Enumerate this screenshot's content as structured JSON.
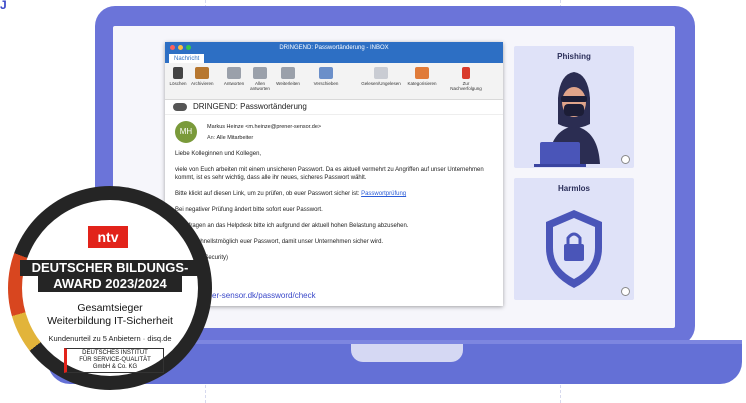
{
  "corner_mark": "J",
  "mail": {
    "window_title": "DRINGEND: Passwortänderung - INBOX",
    "ribbon_tab": "Nachricht",
    "toolbar": [
      {
        "label": "Löschen",
        "icon": "delete-icon"
      },
      {
        "label": "Archivieren",
        "icon": "archive-icon"
      },
      {
        "label": "Antworten",
        "icon": "reply-icon"
      },
      {
        "label": "Allen antworten",
        "icon": "reply-all-icon"
      },
      {
        "label": "Weiterleiten",
        "icon": "forward-icon"
      },
      {
        "label": "Verschieben",
        "icon": "move-icon"
      },
      {
        "label": "Gelesen/Ungelesen",
        "icon": "read-unread-icon"
      },
      {
        "label": "Kategorisieren",
        "icon": "categorize-icon"
      },
      {
        "label": "Zur Nachverfolgung",
        "icon": "flag-icon"
      }
    ],
    "subject": "DRINGEND: Passwortänderung",
    "avatar_initials": "MH",
    "sender": "Markus Heinze <m.heinze@prener-sensor.de>",
    "to_label": "An:",
    "to_value": "Alle Mitarbeiter",
    "body": {
      "greeting": "Liebe Kolleginnen und Kollegen,",
      "p1": "viele von Euch arbeiten mit einem unsicheren Passwort. Da es aktuell vermehrt zu Angriffen auf unser Unternehmen kommt, ist es sehr wichtig, dass alle ihr neues, sicheres Passwort wählt.",
      "p2_text": "Bitte klickt auf diesen Link, um zu prüfen, ob euer Passwort sicher ist:",
      "p2_link": "Passwortprüfung",
      "p3": "Bei negativer Prüfung ändert bitte sofort euer Passwort.",
      "p4": "Rückfragen an das Helpdesk bitte ich aufgrund der aktuell hohen Belastung abzusehen.",
      "p5": "Ändert schnellstmöglich euer Passwort, damit unser Unternehmen sicher wird.",
      "p6": "Heinze (IT-Security)"
    },
    "status_url": "prener-sensor.dk/password/check"
  },
  "cards": {
    "phishing_title": "Phishing",
    "harmless_title": "Harmlos"
  },
  "badge": {
    "logo": "ntv",
    "line1": "DEUTSCHER BILDUNGS-",
    "line2": "AWARD 2023/2024",
    "line3": "Gesamtsieger",
    "line4": "Weiterbildung IT-Sicherheit",
    "line5": "Kundenurteil zu 5 Anbietern · disq.de",
    "seal_l1": "DEUTSCHES INSTITUT",
    "seal_l2": "FÜR SERVICE-QUALITÄT",
    "seal_l3": "GmbH & Co. KG"
  },
  "colors": {
    "laptop": "#6b74d9",
    "titlebar": "#2d6fc4",
    "card_bg": "#dfe2f8",
    "ntv_red": "#e2231a",
    "shield": "#4a55b8"
  }
}
